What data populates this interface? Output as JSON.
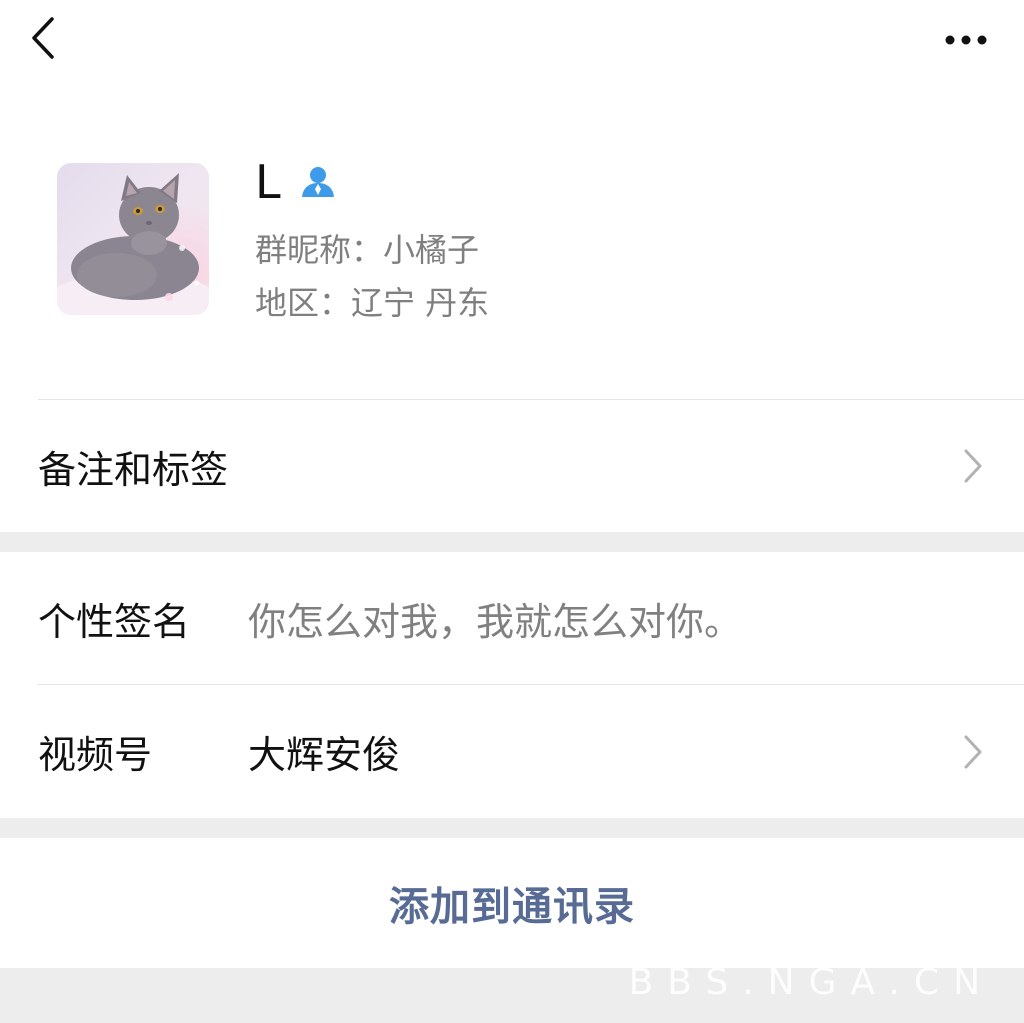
{
  "nav": {
    "back_icon": "chevron-left-icon",
    "more_icon": "more-dots-icon"
  },
  "profile": {
    "avatar_icon": "cat-photo",
    "name": "L",
    "badge_icon": "person-icon",
    "group_nickname": "群昵称：小橘子",
    "region": "地区：辽宁 丹东"
  },
  "rows": {
    "remarks_label": "备注和标签",
    "signature_label": "个性签名",
    "signature_value": "你怎么对我，我就怎么对你。",
    "channels_label": "视频号",
    "channels_value": "大辉安俊"
  },
  "actions": {
    "add_contact": "添加到通讯录"
  },
  "watermark": "BBS.NGA.CN",
  "colors": {
    "link": "#576b95",
    "badge": "#3d9be9",
    "secondary_text": "#7f7f7f",
    "background": "#ededed"
  }
}
